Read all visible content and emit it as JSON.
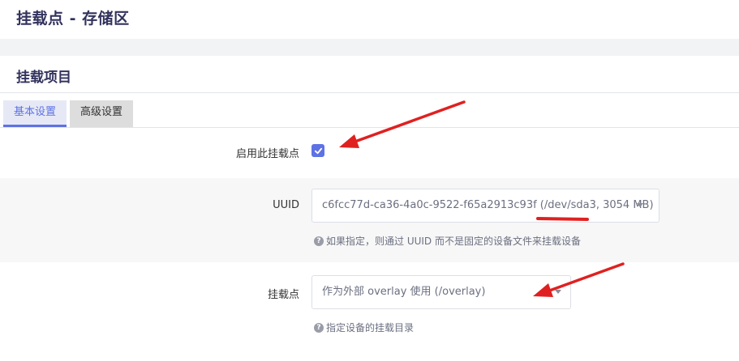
{
  "page": {
    "title": "挂载点 - 存储区"
  },
  "section": {
    "title": "挂载项目"
  },
  "tabs": [
    {
      "label": "基本设置",
      "active": true
    },
    {
      "label": "高级设置",
      "active": false
    }
  ],
  "fields": {
    "enable": {
      "label": "启用此挂载点",
      "checked": true
    },
    "uuid": {
      "label": "UUID",
      "value": "c6fcc77d-ca36-4a0c-9522-f65a2913c93f (/dev/sda3, 3054 MB)",
      "help": "如果指定，则通过 UUID 而不是固定的设备文件来挂载设备"
    },
    "mountpoint": {
      "label": "挂载点",
      "value": "作为外部 overlay 使用 (/overlay)",
      "help": "指定设备的挂载目录"
    }
  },
  "colors": {
    "accent": "#5e72e4",
    "annotation": "#e02020"
  }
}
